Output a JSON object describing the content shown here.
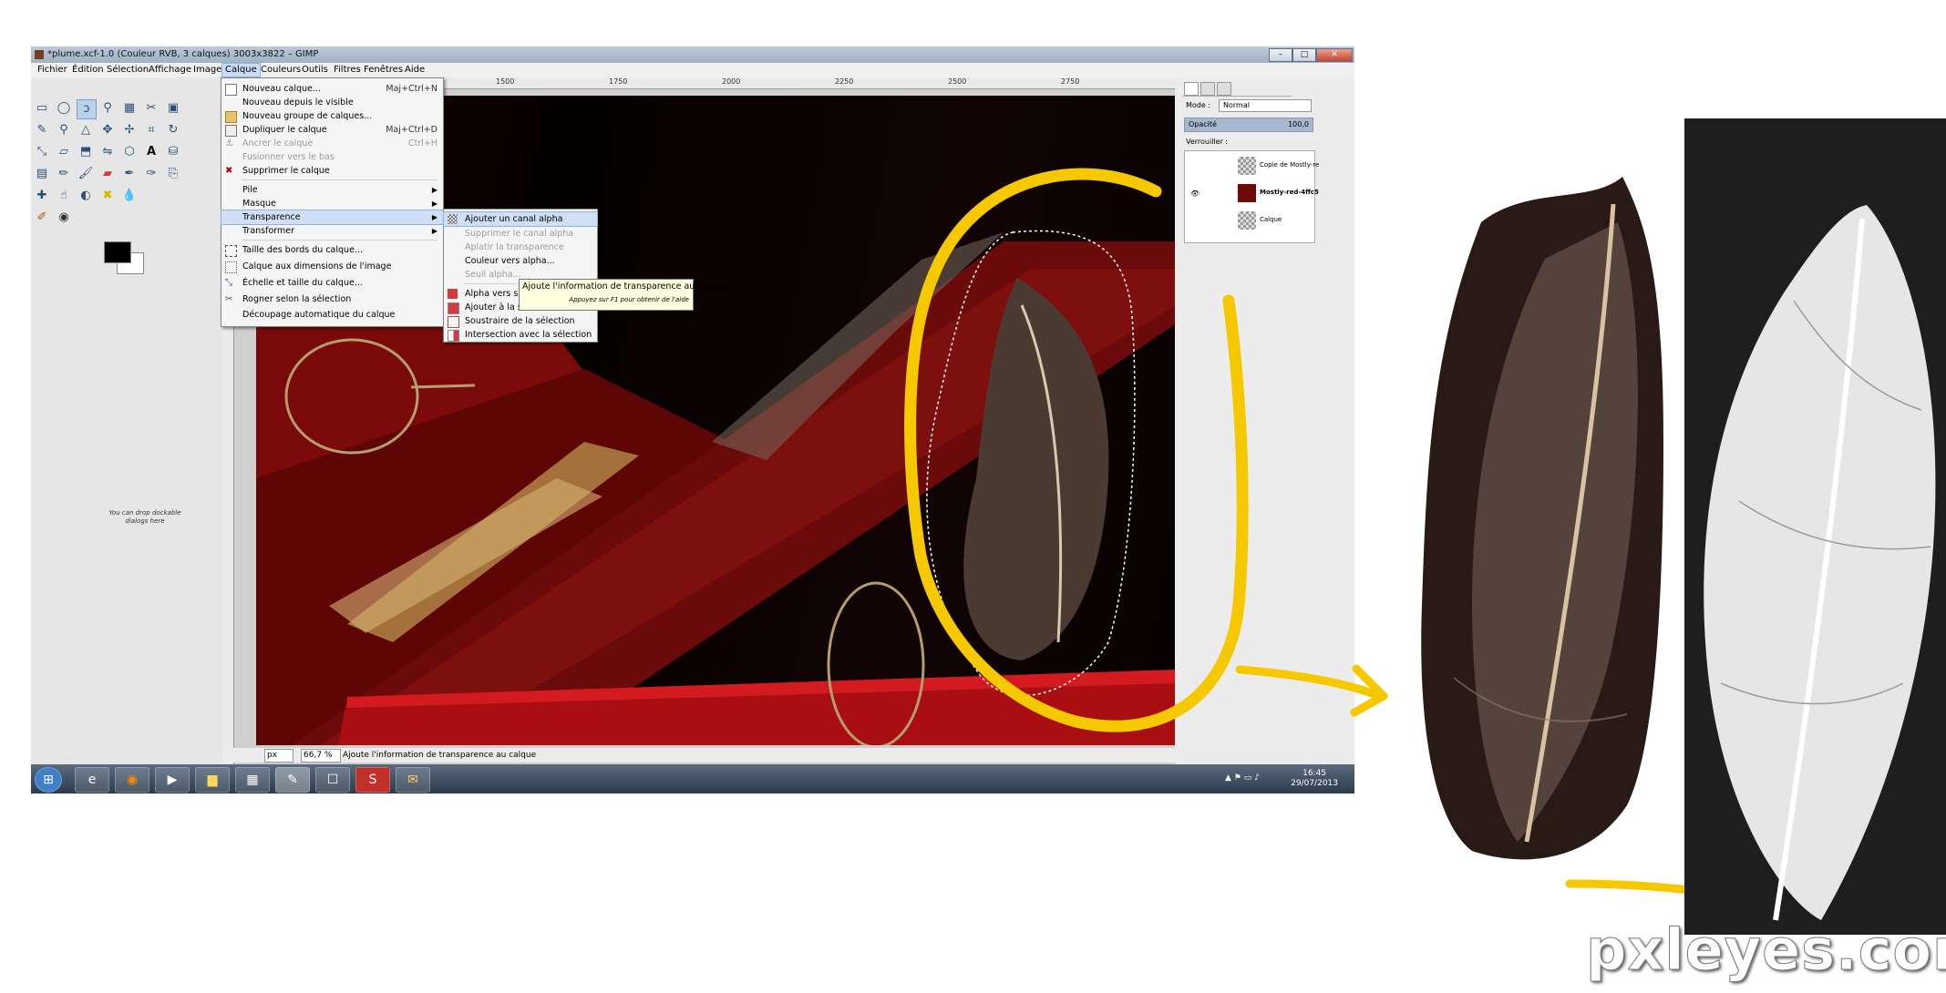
{
  "window": {
    "title": "*plume.xcf-1.0 (Couleur RVB, 3 calques) 3003x3822 – GIMP",
    "btn_min": "–",
    "btn_max": "□",
    "btn_close": "✕"
  },
  "menubar": [
    "Fichier",
    "Édition",
    "Sélection",
    "Affichage",
    "Image",
    "Calque",
    "Couleurs",
    "Outils",
    "Filtres",
    "Fenêtres",
    "Aide"
  ],
  "toolbox": {
    "dock_note": "You can drop dockable dialogs here"
  },
  "ruler_ticks": [
    "1500",
    "1750",
    "2000",
    "2250",
    "2500",
    "2750"
  ],
  "calque_menu": [
    {
      "label": "Nouveau calque...",
      "shortcut": "Maj+Ctrl+N",
      "disabled": false
    },
    {
      "label": "Nouveau depuis le visible",
      "shortcut": "",
      "disabled": false
    },
    {
      "label": "Nouveau groupe de calques...",
      "shortcut": "",
      "disabled": false
    },
    {
      "label": "Dupliquer le calque",
      "shortcut": "Maj+Ctrl+D",
      "disabled": false
    },
    {
      "label": "Ancrer le calque",
      "shortcut": "Ctrl+H",
      "disabled": true
    },
    {
      "label": "Fusionner vers le bas",
      "shortcut": "",
      "disabled": true
    },
    {
      "label": "Supprimer le calque",
      "shortcut": "",
      "disabled": false
    },
    {
      "label": "Pile",
      "shortcut": "",
      "disabled": false
    },
    {
      "label": "Masque",
      "shortcut": "",
      "disabled": false
    },
    {
      "label": "Transparence",
      "shortcut": "",
      "disabled": false
    },
    {
      "label": "Transformer",
      "shortcut": "",
      "disabled": false
    },
    {
      "label": "Taille des bords du calque...",
      "shortcut": "",
      "disabled": false
    },
    {
      "label": "Calque aux dimensions de l'image",
      "shortcut": "",
      "disabled": false
    },
    {
      "label": "Échelle et taille du calque...",
      "shortcut": "",
      "disabled": false
    },
    {
      "label": "Rogner selon la sélection",
      "shortcut": "",
      "disabled": false
    },
    {
      "label": "Découpage automatique du calque",
      "shortcut": "",
      "disabled": false
    }
  ],
  "transparence_menu": [
    {
      "label": "Ajouter un canal alpha",
      "disabled": false
    },
    {
      "label": "Supprimer le canal alpha",
      "disabled": true
    },
    {
      "label": "Aplatir la transparence",
      "disabled": true
    },
    {
      "label": "Couleur vers alpha...",
      "disabled": false
    },
    {
      "label": "Seuil alpha...",
      "disabled": true
    },
    {
      "label": "Alpha vers sélection",
      "disabled": false
    },
    {
      "label": "Ajouter à la sélection",
      "disabled": false
    },
    {
      "label": "Soustraire de la sélection",
      "disabled": false
    },
    {
      "label": "Intersection avec la sélection",
      "disabled": false
    }
  ],
  "tooltip": {
    "main": "Ajoute l'information de transparence au calque",
    "help": "Appuyez sur F1 pour obtenir de l'aide"
  },
  "layers_dock": {
    "mode_label": "Mode :",
    "mode_value": "Normal",
    "opacity_label": "Opacité",
    "opacity_value": "100,0",
    "lock_label": "Verrouiller :",
    "layers": [
      "Copie de Mostly-re",
      "Mostly-red-4ffc5",
      "Calque"
    ]
  },
  "statusbar": {
    "unit": "px",
    "zoom": "66,7 %",
    "message": "Ajoute l'information de transparence au calque"
  },
  "taskbar": {
    "time": "16:45",
    "date": "29/07/2013"
  },
  "watermark": "pxleyes.com",
  "colors": {
    "annotation_yellow": "#f5c800",
    "menu_highlight": "#cfe0f6"
  }
}
